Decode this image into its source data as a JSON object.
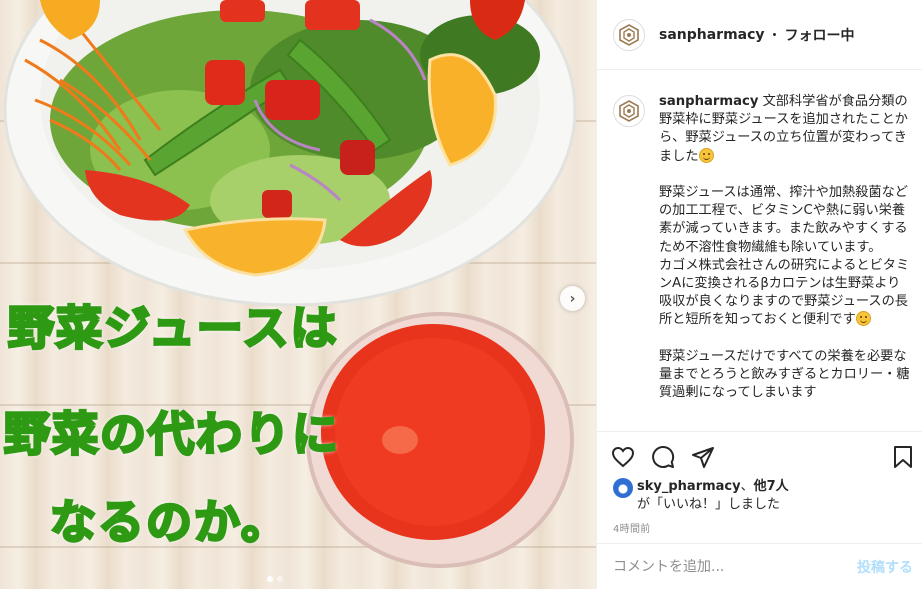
{
  "post": {
    "image": {
      "overlay_lines": [
        "野菜ジュースは",
        "野菜の代わりに",
        "なるのか。"
      ],
      "next_glyph": "›",
      "carousel_count": 2,
      "carousel_active": 1
    },
    "header": {
      "username": "sanpharmacy",
      "separator": "・",
      "follow_label": "フォロー中"
    },
    "caption": {
      "username": "sanpharmacy",
      "paragraph_1": " 文部科学省が食品分類の野菜枠に野菜ジュースを追加されたことから、野菜ジュースの立ち位置が変わってきました",
      "paragraph_2": "野菜ジュースは通常、搾汁や加熱殺菌などの加工工程で、ビタミンCや熱に弱い栄養素が減っていきます。また飲みやすくするため不溶性食物繊維も除いています。\nカゴメ株式会社さんの研究によるとビタミンAに変換されるβカロテンは生野菜より吸収が良くなりますので野菜ジュースの長所と短所を知っておくと便利です",
      "paragraph_3": "野菜ジュースだけですべての栄養を必要な量までとろうと飲みすぎるとカロリー・糖質過剰になってしまいます"
    },
    "actions": {
      "like_icon": "heart-icon",
      "comment_icon": "comment-icon",
      "share_icon": "share-icon",
      "save_icon": "bookmark-icon"
    },
    "likes": {
      "liker_username": "sky_pharmacy",
      "separator": "、",
      "others": "他7人",
      "suffix": "が「いいね！」しました"
    },
    "timestamp": "4時間前",
    "comment": {
      "placeholder": "コメントを追加...",
      "post_label": "投稿する"
    }
  }
}
